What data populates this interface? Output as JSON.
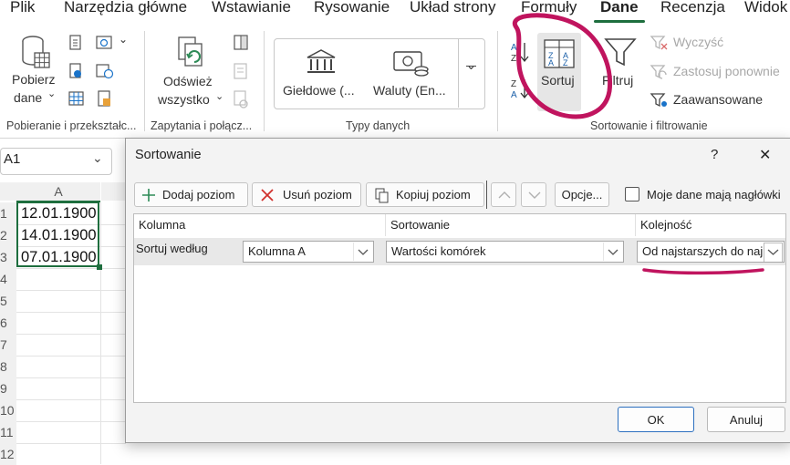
{
  "menu": {
    "items": [
      "Plik",
      "Narzędzia główne",
      "Wstawianie",
      "Rysowanie",
      "Układ strony",
      "Formuły",
      "Dane",
      "Recenzja",
      "Widok"
    ],
    "active": "Dane"
  },
  "ribbon": {
    "get_data_label1": "Pobierz",
    "get_data_label2": "dane",
    "refresh_label1": "Odśwież",
    "refresh_label2": "wszystko",
    "stocks_label": "Giełdowe (...",
    "currencies_label": "Waluty (En...",
    "sort_label": "Sortuj",
    "filter_label": "Filtruj",
    "clear_label": "Wyczyść",
    "reapply_label": "Zastosuj ponownie",
    "advanced_label": "Zaawansowane",
    "groups": {
      "get_transform": "Pobieranie i przekształc...",
      "queries": "Zapytania i połącz...",
      "data_types": "Typy danych",
      "sort_filter": "Sortowanie i filtrowanie"
    }
  },
  "namebox": {
    "value": "A1"
  },
  "sheet": {
    "col_a": "A",
    "rows": [
      "1",
      "2",
      "3",
      "4",
      "5",
      "6",
      "7",
      "8",
      "9",
      "10",
      "11",
      "12"
    ],
    "cells": [
      "12.01.1900",
      "14.01.1900",
      "07.01.1900"
    ]
  },
  "dialog": {
    "title": "Sortowanie",
    "help": "?",
    "close": "✕",
    "add_level": "Dodaj poziom",
    "delete_level": "Usuń poziom",
    "copy_level": "Kopiuj poziom",
    "options": "Opcje...",
    "headers_checkbox": "Moje dane mają nagłówki",
    "headers_checked": false,
    "col_header": "Kolumna",
    "sort_header": "Sortowanie",
    "order_header": "Kolejność",
    "row_label": "Sortuj według",
    "column_value": "Kolumna A",
    "sort_on_value": "Wartości komórek",
    "order_value": "Od najstarszych do naj",
    "ok": "OK",
    "cancel": "Anuluj"
  },
  "colors": {
    "accent_green": "#1e6e3e",
    "annotation": "#c0145e"
  }
}
